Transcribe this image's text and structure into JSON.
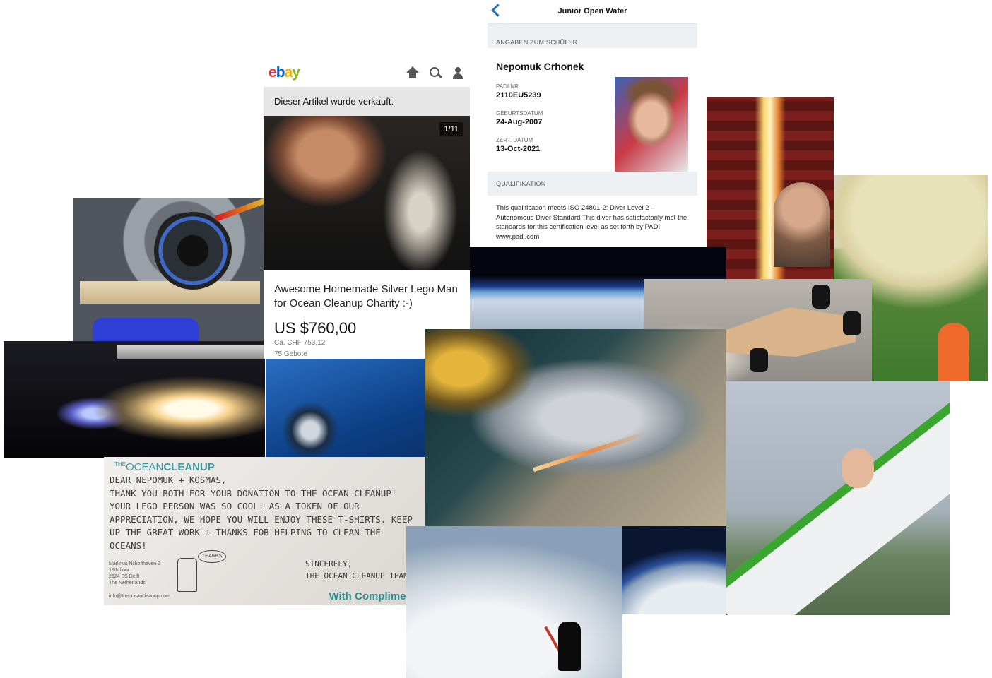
{
  "ebay": {
    "logo": [
      "e",
      "b",
      "a",
      "y"
    ],
    "sold_banner": "Dieser Artikel wurde verkauft.",
    "photo_counter": "1/11",
    "title": "Awesome Homemade Silver Lego Man for Ocean Cleanup Charity :-)",
    "price": "US $760,00",
    "price_chf": "Ca. CHF 753,12",
    "bids": "75 Gebote"
  },
  "padi": {
    "title": "Junior Open Water",
    "section_student": "ANGABEN ZUM SCHÜLER",
    "name": "Nepomuk Crhonek",
    "padi_nr_label": "PADI NR.",
    "padi_nr": "2110EU5239",
    "birthdate_label": "GEBURTSDATUM",
    "birthdate": "24-Aug-2007",
    "cert_date_label": "ZERT. DATUM",
    "cert_date": "13-Oct-2021",
    "section_qual": "QUALIFIKATION",
    "qualification": "This qualification meets ISO 24801-2: Diver Level 2 – Autonomous Diver Standard This diver has satisfactorily met the standards for this certification level as set forth by PADI www.padi.com"
  },
  "letter": {
    "brand_prefix": "THE",
    "brand_ocean": "OCEAN",
    "brand_cleanup": "CLEANUP",
    "lines": [
      "DEAR NEPOMUK + KOSMAS,",
      "THANK YOU BOTH FOR YOUR DONATION TO THE OCEAN CLEANUP!",
      "YOUR LEGO PERSON WAS SO COOL! AS A TOKEN OF OUR",
      "APPRECIATION, WE HOPE YOU WILL ENJOY THESE T-SHIRTS. KEEP",
      "UP THE GREAT WORK + THANKS FOR HELPING TO CLEAN THE",
      "OCEANS!"
    ],
    "closing": "SINCERELY,",
    "signature": "THE OCEAN CLEANUP TEAM",
    "bubble": "THANKS",
    "address": [
      "Marlinus Nijhoffhaven 2",
      "18th floor",
      "2624 ES Delft",
      "The Netherlands"
    ],
    "email": "info@theoceancleanup.com",
    "compliments": "With Compliments"
  }
}
